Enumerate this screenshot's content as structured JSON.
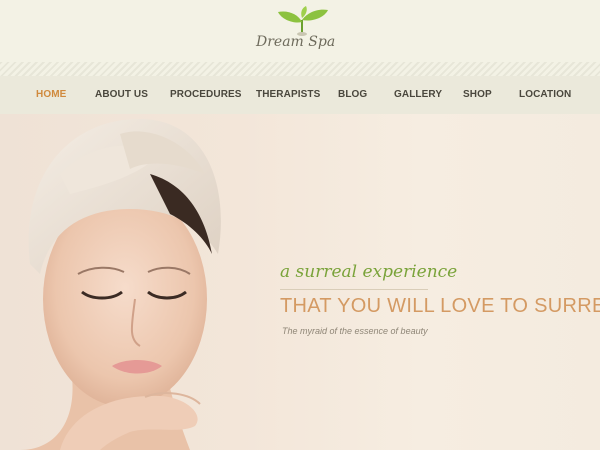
{
  "brand": {
    "logo_text_1": "Dream",
    "logo_text_2": "Spa",
    "leaf_color": "#8cc23f",
    "stem_color": "#6aa02d"
  },
  "nav": {
    "items": [
      {
        "label": "HOME",
        "active": true
      },
      {
        "label": "ABOUT US",
        "active": false
      },
      {
        "label": "PROCEDURES",
        "active": false
      },
      {
        "label": "THERAPISTS",
        "active": false
      },
      {
        "label": "BLOG",
        "active": false
      },
      {
        "label": "GALLERY",
        "active": false
      },
      {
        "label": "SHOP",
        "active": false
      },
      {
        "label": "LOCATION",
        "active": false
      }
    ],
    "active_color": "#d08a3d"
  },
  "hero": {
    "tagline": "a surreal experience",
    "headline": "THAT YOU WILL LOVE TO SURREND",
    "subline": "The myraid of the essence of beauty",
    "tagline_color": "#7aa33a",
    "headline_color": "#d49a63"
  }
}
